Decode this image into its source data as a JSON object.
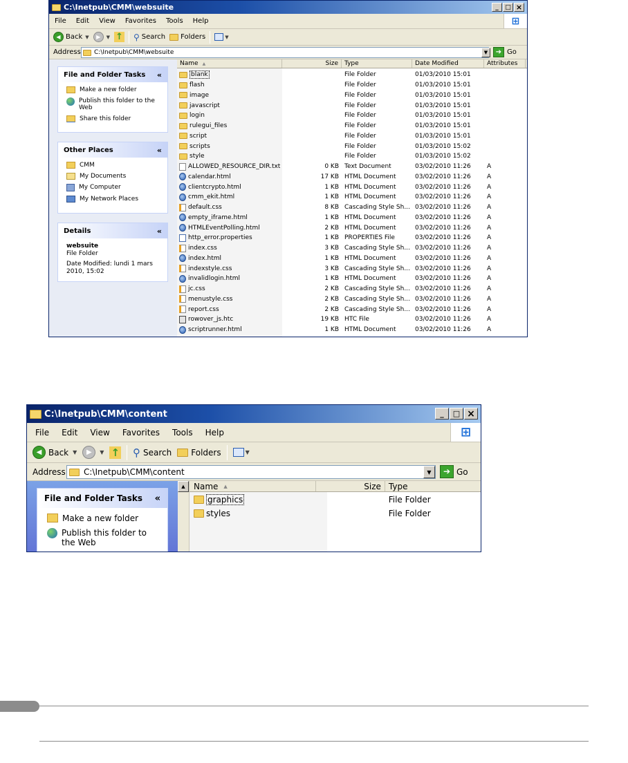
{
  "window1": {
    "title": "C:\\Inetpub\\CMM\\websuite",
    "menu": [
      "File",
      "Edit",
      "View",
      "Favorites",
      "Tools",
      "Help"
    ],
    "toolbar": {
      "back": "Back",
      "search": "Search",
      "folders": "Folders"
    },
    "address_label": "Address",
    "address_value": "C:\\Inetpub\\CMM\\websuite",
    "go": "Go",
    "tasks_title": "File and Folder Tasks",
    "tasks": [
      "Make a new folder",
      "Publish this folder to the Web",
      "Share this folder"
    ],
    "places_title": "Other Places",
    "places": [
      "CMM",
      "My Documents",
      "My Computer",
      "My Network Places"
    ],
    "details_title": "Details",
    "details_name": "websuite",
    "details_type": "File Folder",
    "details_modified": "Date Modified: lundi 1 mars 2010, 15:02",
    "columns": [
      "Name",
      "Size",
      "Type",
      "Date Modified",
      "Attributes"
    ],
    "files": [
      {
        "name": "blank",
        "size": "",
        "type": "File Folder",
        "date": "01/03/2010 15:01",
        "attr": "",
        "icon": "folder"
      },
      {
        "name": "flash",
        "size": "",
        "type": "File Folder",
        "date": "01/03/2010 15:01",
        "attr": "",
        "icon": "folder"
      },
      {
        "name": "image",
        "size": "",
        "type": "File Folder",
        "date": "01/03/2010 15:01",
        "attr": "",
        "icon": "folder"
      },
      {
        "name": "javascript",
        "size": "",
        "type": "File Folder",
        "date": "01/03/2010 15:01",
        "attr": "",
        "icon": "folder"
      },
      {
        "name": "login",
        "size": "",
        "type": "File Folder",
        "date": "01/03/2010 15:01",
        "attr": "",
        "icon": "folder"
      },
      {
        "name": "rulegui_files",
        "size": "",
        "type": "File Folder",
        "date": "01/03/2010 15:01",
        "attr": "",
        "icon": "folder"
      },
      {
        "name": "script",
        "size": "",
        "type": "File Folder",
        "date": "01/03/2010 15:01",
        "attr": "",
        "icon": "folder"
      },
      {
        "name": "scripts",
        "size": "",
        "type": "File Folder",
        "date": "01/03/2010 15:02",
        "attr": "",
        "icon": "folder"
      },
      {
        "name": "style",
        "size": "",
        "type": "File Folder",
        "date": "01/03/2010 15:02",
        "attr": "",
        "icon": "folder"
      },
      {
        "name": "ALLOWED_RESOURCE_DIR.txt",
        "size": "0 KB",
        "type": "Text Document",
        "date": "03/02/2010 11:26",
        "attr": "A",
        "icon": "txt"
      },
      {
        "name": "calendar.html",
        "size": "17 KB",
        "type": "HTML Document",
        "date": "03/02/2010 11:26",
        "attr": "A",
        "icon": "html"
      },
      {
        "name": "clientcrypto.html",
        "size": "1 KB",
        "type": "HTML Document",
        "date": "03/02/2010 11:26",
        "attr": "A",
        "icon": "html"
      },
      {
        "name": "cmm_ekit.html",
        "size": "1 KB",
        "type": "HTML Document",
        "date": "03/02/2010 11:26",
        "attr": "A",
        "icon": "html"
      },
      {
        "name": "default.css",
        "size": "8 KB",
        "type": "Cascading Style Sh...",
        "date": "03/02/2010 11:26",
        "attr": "A",
        "icon": "css"
      },
      {
        "name": "empty_iframe.html",
        "size": "1 KB",
        "type": "HTML Document",
        "date": "03/02/2010 11:26",
        "attr": "A",
        "icon": "html"
      },
      {
        "name": "HTMLEventPolling.html",
        "size": "2 KB",
        "type": "HTML Document",
        "date": "03/02/2010 11:26",
        "attr": "A",
        "icon": "html"
      },
      {
        "name": "http_error.properties",
        "size": "1 KB",
        "type": "PROPERTIES File",
        "date": "03/02/2010 11:26",
        "attr": "A",
        "icon": "prop"
      },
      {
        "name": "index.css",
        "size": "3 KB",
        "type": "Cascading Style Sh...",
        "date": "03/02/2010 11:26",
        "attr": "A",
        "icon": "css"
      },
      {
        "name": "index.html",
        "size": "1 KB",
        "type": "HTML Document",
        "date": "03/02/2010 11:26",
        "attr": "A",
        "icon": "html"
      },
      {
        "name": "indexstyle.css",
        "size": "3 KB",
        "type": "Cascading Style Sh...",
        "date": "03/02/2010 11:26",
        "attr": "A",
        "icon": "css"
      },
      {
        "name": "invalidlogin.html",
        "size": "1 KB",
        "type": "HTML Document",
        "date": "03/02/2010 11:26",
        "attr": "A",
        "icon": "html"
      },
      {
        "name": "jc.css",
        "size": "2 KB",
        "type": "Cascading Style Sh...",
        "date": "03/02/2010 11:26",
        "attr": "A",
        "icon": "css"
      },
      {
        "name": "menustyle.css",
        "size": "2 KB",
        "type": "Cascading Style Sh...",
        "date": "03/02/2010 11:26",
        "attr": "A",
        "icon": "css"
      },
      {
        "name": "report.css",
        "size": "2 KB",
        "type": "Cascading Style Sh...",
        "date": "03/02/2010 11:26",
        "attr": "A",
        "icon": "css"
      },
      {
        "name": "rowover_js.htc",
        "size": "19 KB",
        "type": "HTC File",
        "date": "03/02/2010 11:26",
        "attr": "A",
        "icon": "htc"
      },
      {
        "name": "scriptrunner.html",
        "size": "1 KB",
        "type": "HTML Document",
        "date": "03/02/2010 11:26",
        "attr": "A",
        "icon": "html"
      }
    ]
  },
  "window2": {
    "title": "C:\\Inetpub\\CMM\\content",
    "menu": [
      "File",
      "Edit",
      "View",
      "Favorites",
      "Tools",
      "Help"
    ],
    "toolbar": {
      "back": "Back",
      "search": "Search",
      "folders": "Folders"
    },
    "address_label": "Address",
    "address_value": "C:\\Inetpub\\CMM\\content",
    "go": "Go",
    "tasks_title": "File and Folder Tasks",
    "tasks": [
      "Make a new folder",
      "Publish this folder to the Web"
    ],
    "columns": [
      "Name",
      "Size",
      "Type"
    ],
    "files": [
      {
        "name": "graphics",
        "type": "File Folder",
        "icon": "folder"
      },
      {
        "name": "styles",
        "type": "File Folder",
        "icon": "folder"
      }
    ]
  },
  "icons": {
    "minimize": "_",
    "maximize": "□",
    "close": "×",
    "back_arrow": "◀",
    "forward_arrow": "▶",
    "up": "↑",
    "search": "⚲",
    "dropdown": "▼",
    "collapse": "«",
    "sort_asc": "▲",
    "go_arrow": "➔",
    "windows_logo": "⊞"
  }
}
